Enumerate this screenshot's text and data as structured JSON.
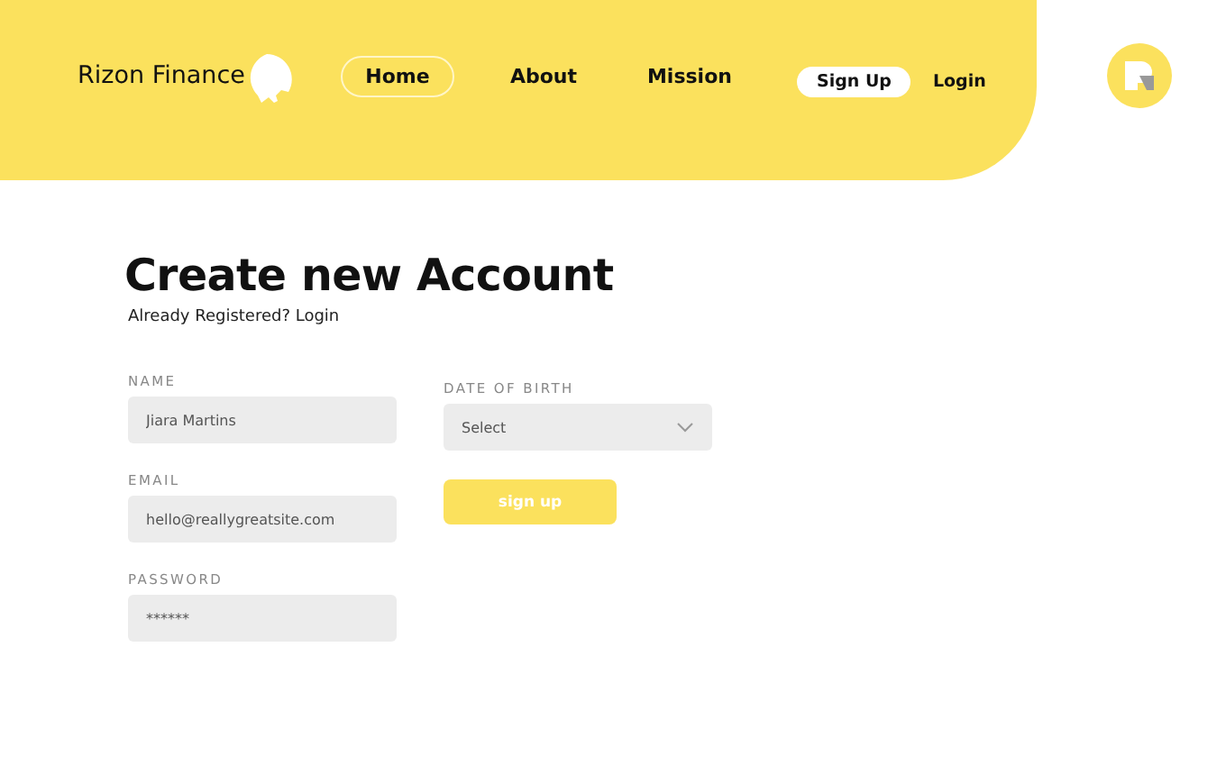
{
  "header": {
    "brand": "Rizon Finance",
    "nav": [
      {
        "label": "Home",
        "selected": true
      },
      {
        "label": "About",
        "selected": false
      },
      {
        "label": "Mission",
        "selected": false
      }
    ],
    "actions": [
      {
        "label": "Sign Up",
        "kind": "pill"
      },
      {
        "label": "Login",
        "kind": "link"
      }
    ]
  },
  "form": {
    "title": "Create new Account",
    "subtitle": "Already Registered? Login",
    "left_fields": [
      {
        "label": "NAME",
        "value": "Jiara Martins",
        "kind": "text"
      },
      {
        "label": "EMAIL",
        "value": "hello@reallygreatsite.com",
        "kind": "text"
      },
      {
        "label": "PASSWORD",
        "value": "******",
        "kind": "text"
      }
    ],
    "right_fields": [
      {
        "label": "DATE OF BIRTH",
        "value": "Select",
        "kind": "select"
      }
    ],
    "submit": "sign up"
  }
}
